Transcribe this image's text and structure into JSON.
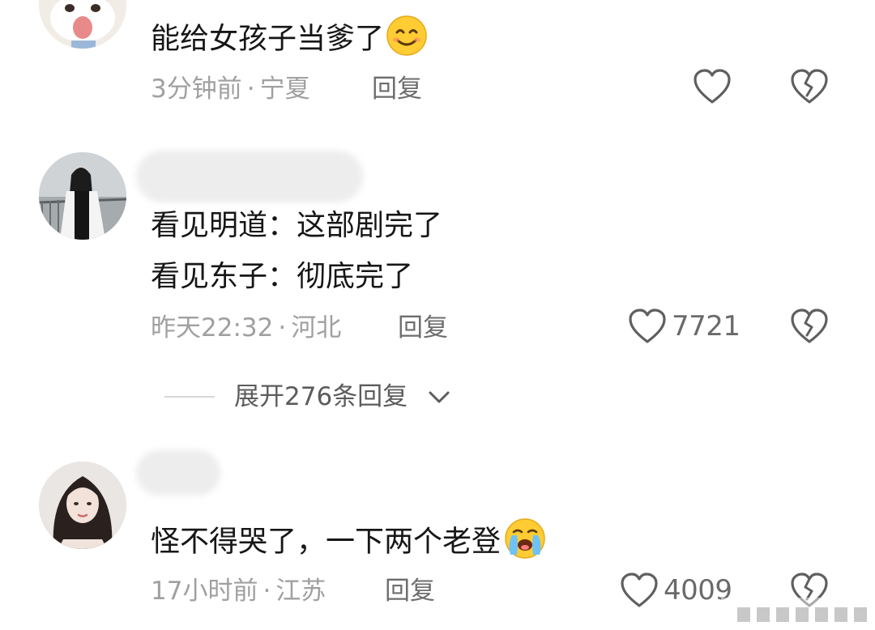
{
  "comments": [
    {
      "text": "能给女孩子当爹了",
      "emoji": "smiling-face-emoji",
      "time": "3分钟前",
      "separator": "·",
      "location": "宁夏",
      "reply_label": "回复",
      "likes": ""
    },
    {
      "lines": [
        "看见明道：这部剧完了",
        "看见东子：彻底完了"
      ],
      "time": "昨天22:32",
      "separator": "·",
      "location": "河北",
      "reply_label": "回复",
      "likes": "7721"
    },
    {
      "text": "怪不得哭了，一下两个老登",
      "emoji": "crying-face-emoji",
      "time": "17小时前",
      "separator": "·",
      "location": "江苏",
      "reply_label": "回复",
      "likes": "4009"
    }
  ],
  "expand_replies": {
    "label": "展开276条回复"
  },
  "icons": {
    "like": "heart-outline-icon",
    "dislike": "broken-heart-icon",
    "expand": "chevron-down-icon"
  },
  "colors": {
    "text": "#161616",
    "meta": "#a0a0a0",
    "reply": "#6d6d6d",
    "icon": "#5f5f5f"
  }
}
